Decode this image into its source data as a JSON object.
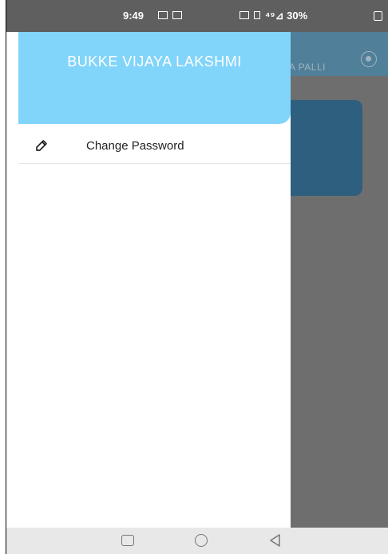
{
  "status_bar": {
    "time": "9:49",
    "right_text": "⁴⁹⊿ 30%"
  },
  "background_app": {
    "header_text": "A PALLI"
  },
  "drawer": {
    "user_name": "BUKKE VIJAYA LAKSHMI",
    "menu_items": [
      {
        "label": "Change Password",
        "icon": "edit-icon"
      }
    ]
  },
  "navigation_bar": {
    "icons": [
      "recent-apps-icon",
      "home-icon",
      "back-icon"
    ]
  },
  "colors": {
    "drawer_header": "#81d4fa",
    "overlay": "#6e6e6e",
    "app_header": "#4f7f99"
  }
}
